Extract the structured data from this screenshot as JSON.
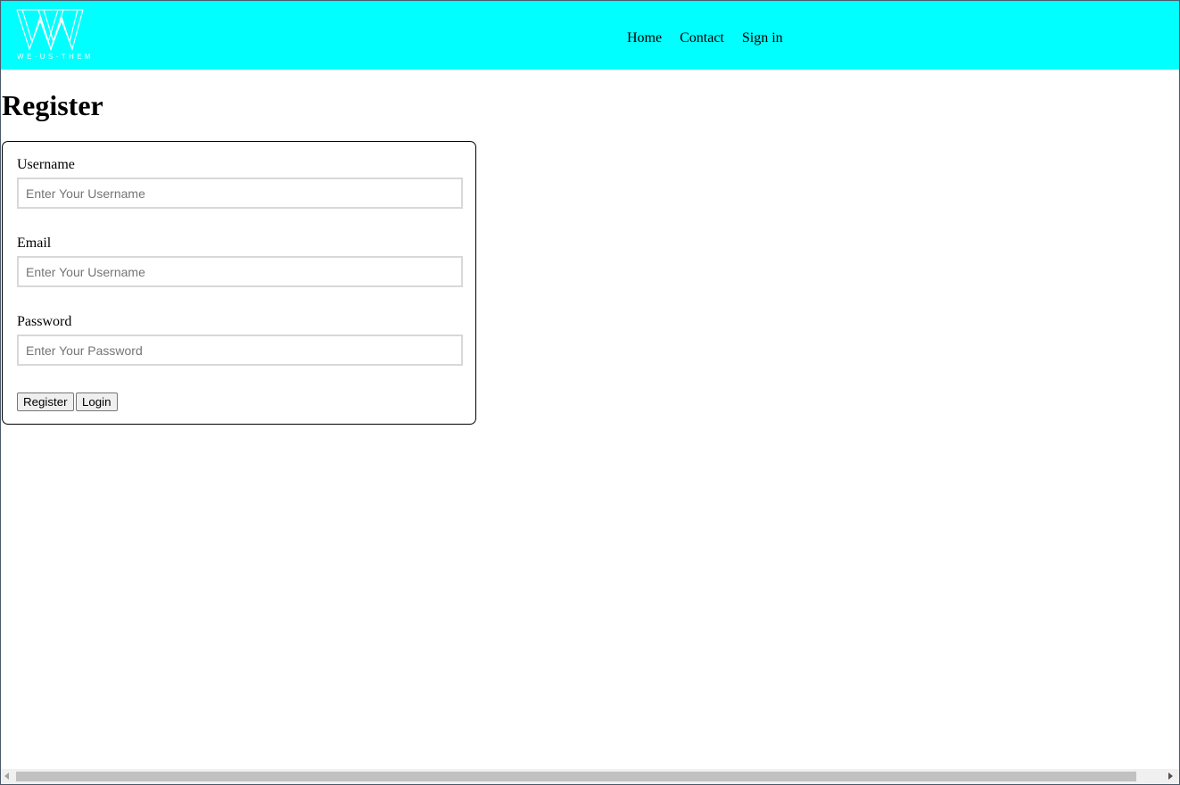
{
  "header": {
    "background_color": "#00ffff",
    "logo": {
      "icon": "w-logo-icon",
      "tagline": "WE·US·THEM"
    },
    "nav": [
      {
        "label": "Home"
      },
      {
        "label": "Contact"
      },
      {
        "label": "Sign in"
      }
    ]
  },
  "main": {
    "title": "Register",
    "form": {
      "username": {
        "label": "Username",
        "placeholder": "Enter Your Username",
        "value": ""
      },
      "email": {
        "label": "Email",
        "placeholder": "Enter Your Username",
        "value": ""
      },
      "password": {
        "label": "Password",
        "placeholder": "Enter Your Password",
        "value": ""
      },
      "register_label": "Register",
      "login_label": "Login"
    }
  }
}
